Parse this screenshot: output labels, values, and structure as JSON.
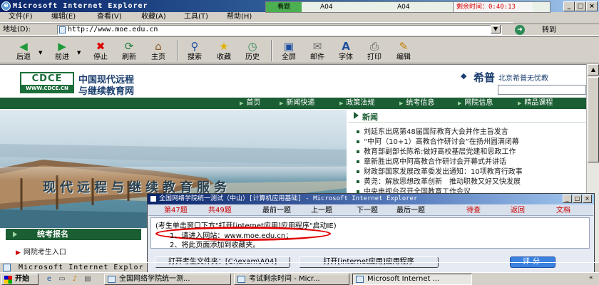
{
  "window": {
    "title": "Microsoft Internet Explorer",
    "minimize": "_",
    "restore": "□",
    "close": "×"
  },
  "exam_status": {
    "tab_label": "看题",
    "code_left": "A04",
    "code_right": "A04",
    "timer": "剩余时间：0:40:13"
  },
  "menu": [
    "文件(F)",
    "编辑(E)",
    "查看(V)",
    "收藏(A)",
    "工具(T)",
    "帮助(H)"
  ],
  "address": {
    "label": "地址(D):",
    "url": "http://www.moe.edu.cn",
    "go_label": "转到"
  },
  "toolbar": {
    "back": "后退",
    "forward": "前进",
    "stop": "停止",
    "refresh": "刷新",
    "home": "主页",
    "search": "搜索",
    "favorites": "收藏",
    "history": "历史",
    "fullscreen": "全屏",
    "mail": "邮件",
    "font": "字体",
    "print": "打印",
    "edit": "编辑"
  },
  "site": {
    "logo_top": "CDCE",
    "logo_bottom": "WWW.CDCE.CN",
    "name_line1": "中国现代远程",
    "name_line2": "与继续教育网",
    "partner_name": "希普",
    "partner_desc": "北京希普无忧教",
    "nav": [
      "首页",
      "新闻快递",
      "政策法规",
      "统考信息",
      "网院信息",
      "精品课程"
    ],
    "banner_text": "现代远程与继续教育服务",
    "news_title": "新闻",
    "news": [
      "刘延东出席第48届国际教育大会并作主旨发言",
      "“中阿（10+1）高教合作研讨会”在扬州圆满闭幕",
      "教育部副部长陈希:做好高校基层党建和思政工作",
      "章新胜出席中阿高教合作研讨会开幕式并讲话",
      "财政部国家发展改革委发出通知：10项教育行政事",
      "黄尧：解放思想改革创新　推动职教又好又快发展",
      "中央电视台召开全国教育工作会议"
    ],
    "signup_title": "统考报名",
    "portal_link": "网院考生入口"
  },
  "dialog": {
    "title": "全国网络学院统一测试（中山）[计算机应用基础] - Microsoft Internet Explorer",
    "question_no": "第47题",
    "total": "共49题",
    "first": "最前一题",
    "prev": "上一题",
    "next": "下一题",
    "last": "最后一题",
    "wait": "待查",
    "back": "返回",
    "doc": "文档",
    "task": "(考生单击窗口下方\"打开[internet应用]应用程序\"启动IE)",
    "step1": "1、请进入网站：www.moe.edu.cn；",
    "step2": "2、将此页面添加到收藏夹。",
    "open_folder": "打开考生文件夹：[C:\\exam\\A04]",
    "open_app": "打开[internet应用]应用程序",
    "grade": "评分"
  },
  "status_text": "Microsoft Internet Explor",
  "taskbar": {
    "start": "开始",
    "tasks": [
      "全国网络学院统一测...",
      "考试剩余时间 - Micr...",
      "Microsoft Internet ..."
    ]
  },
  "colors": {
    "titlebar": "#0a246a",
    "site_green": "#1b5e33",
    "timer_red": "#e00000",
    "grade_blue": "#3b82e0"
  }
}
